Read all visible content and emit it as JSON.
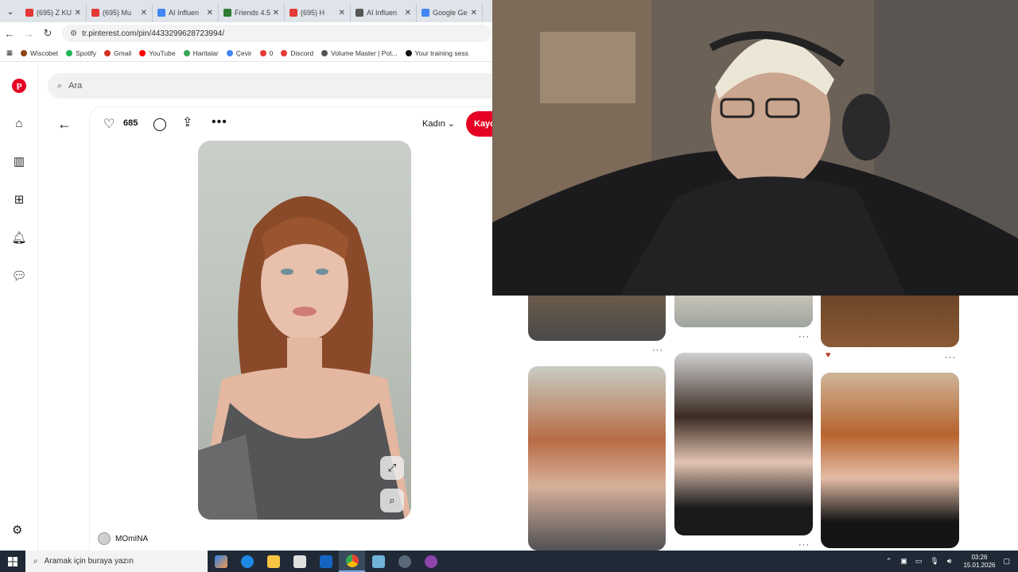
{
  "browser": {
    "tabs": [
      {
        "title": "(695) Z KU",
        "color": "#e53935"
      },
      {
        "title": "(695) Mu",
        "color": "#e53935"
      },
      {
        "title": "AI Influen",
        "color": "#4285f4"
      },
      {
        "title": "Friends 4.5",
        "color": "#2e7d32"
      },
      {
        "title": "(695) H",
        "color": "#e53935"
      },
      {
        "title": "AI Influen",
        "color": "#555555"
      },
      {
        "title": "Google Ge",
        "color": "#4285f4"
      }
    ],
    "url": "tr.pinterest.com/pin/4433299628723994/",
    "bookmarks": [
      {
        "label": "Wiscobet",
        "color": "#8b4513"
      },
      {
        "label": "Spotify",
        "color": "#1db954"
      },
      {
        "label": "Gmail",
        "color": "#d93025"
      },
      {
        "label": "YouTube",
        "color": "#ff0000"
      },
      {
        "label": "Haritalar",
        "color": "#34a853"
      },
      {
        "label": "Çevir",
        "color": "#4285f4"
      },
      {
        "label": "0",
        "color": "#e53935"
      },
      {
        "label": "Discord",
        "color": "#e53935"
      },
      {
        "label": "Volume Master | Pot...",
        "color": "#555555"
      },
      {
        "label": "Your training sess",
        "color": "#111111"
      }
    ]
  },
  "pinterest": {
    "search_placeholder": "Ara",
    "likes": "685",
    "board": "Kadın",
    "save_label": "Kaydet",
    "author": "MOmINA"
  },
  "taskbar": {
    "search_placeholder": "Aramak için buraya yazın",
    "time": "03:26",
    "date": "15.01.2026"
  }
}
